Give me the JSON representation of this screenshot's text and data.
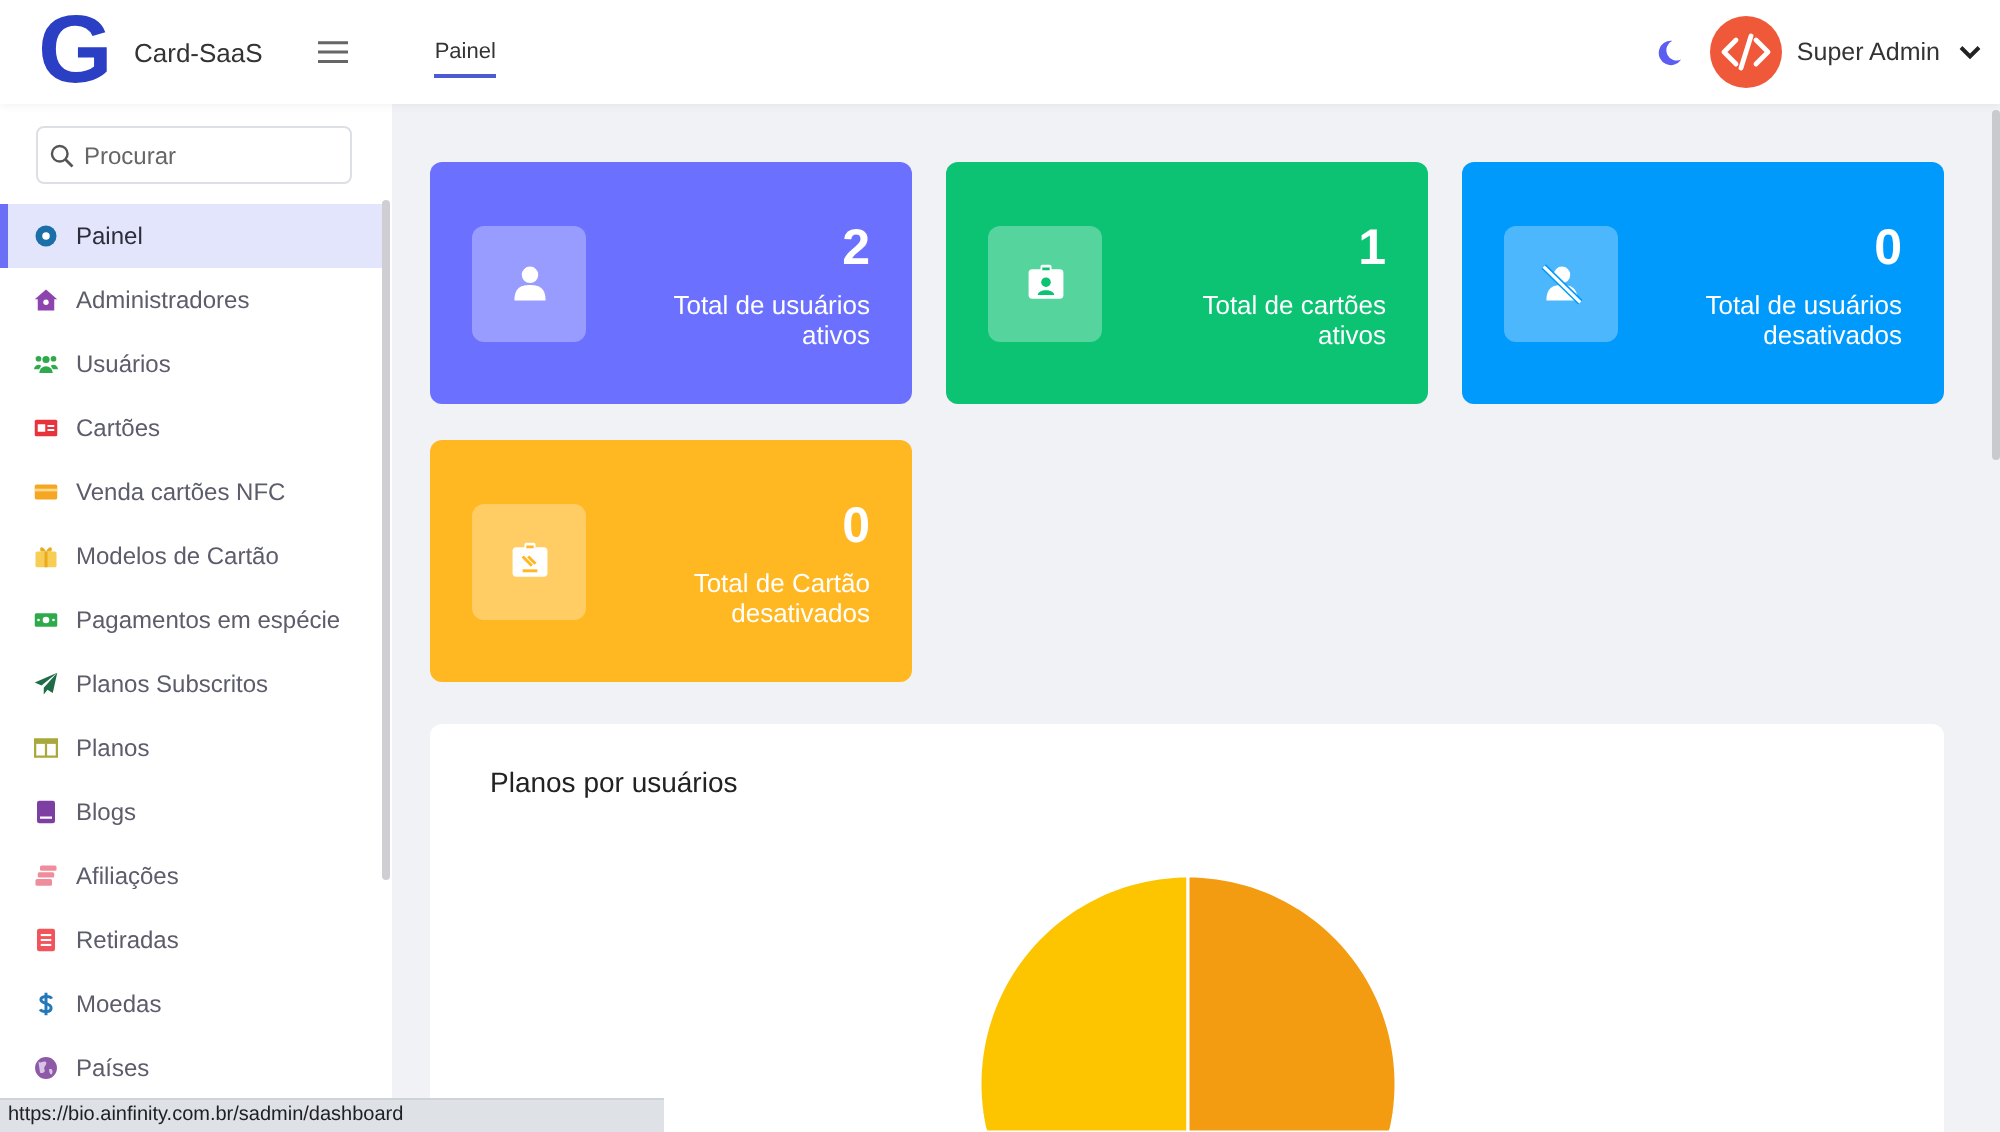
{
  "header": {
    "logo_letter": "G",
    "app_name": "Card-SaaS",
    "nav_tabs": [
      {
        "label": "Painel",
        "selected": true
      }
    ],
    "user_name": "Super Admin"
  },
  "sidebar": {
    "search": {
      "placeholder": "Procurar"
    },
    "items": [
      {
        "label": "Painel",
        "selected": true
      },
      {
        "label": "Administradores",
        "selected": false
      },
      {
        "label": "Usuários",
        "selected": false
      },
      {
        "label": "Cartões",
        "selected": false
      },
      {
        "label": "Venda cartões NFC",
        "selected": false
      },
      {
        "label": "Modelos de Cartão",
        "selected": false
      },
      {
        "label": "Pagamentos em espécie",
        "selected": false
      },
      {
        "label": "Planos Subscritos",
        "selected": false
      },
      {
        "label": "Planos",
        "selected": false
      },
      {
        "label": "Blogs",
        "selected": false
      },
      {
        "label": "Afiliações",
        "selected": false
      },
      {
        "label": "Retiradas",
        "selected": false
      },
      {
        "label": "Moedas",
        "selected": false
      },
      {
        "label": "Países",
        "selected": false
      }
    ]
  },
  "stat_cards": [
    {
      "value": "2",
      "label": "Total de usuários ativos",
      "color": "#6b71fe"
    },
    {
      "value": "1",
      "label": "Total de cartões ativos",
      "color": "#0cc273"
    },
    {
      "value": "0",
      "label": "Total de usuários desativados",
      "color": "#0099fc"
    },
    {
      "value": "0",
      "label": "Total de Cartão desativados",
      "color": "#ffb821"
    }
  ],
  "chart_panel": {
    "title": "Planos por usuários",
    "slices": [
      {
        "color": "#fdc500"
      },
      {
        "color": "#f39c11"
      }
    ]
  },
  "status_url": "https://bio.ainfinity.com.br/sadmin/dashboard"
}
